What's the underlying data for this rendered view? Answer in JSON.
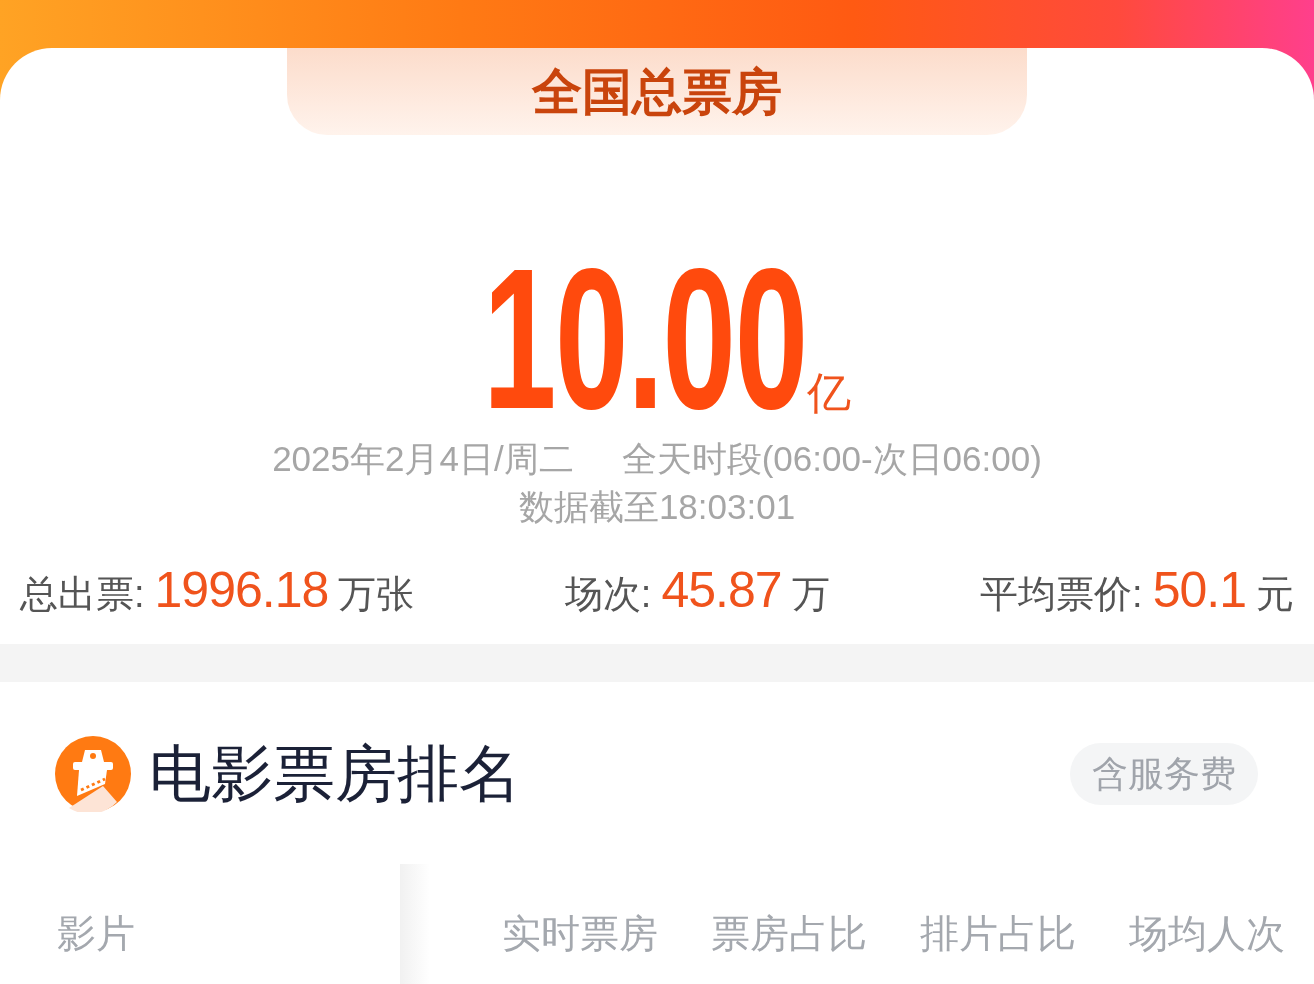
{
  "header": {
    "title": "全国总票房"
  },
  "summary": {
    "total": "10.00",
    "unit": "亿",
    "date": "2025年2月4日/周二",
    "period": "全天时段(06:00-次日06:00)",
    "updated": "数据截至18:03:01",
    "stats": [
      {
        "label": "总出票:",
        "value": "1996.18",
        "unit": "万张"
      },
      {
        "label": "场次:",
        "value": "45.87",
        "unit": "万"
      },
      {
        "label": "平均票价:",
        "value": "50.1",
        "unit": "元"
      }
    ]
  },
  "ranking": {
    "title": "电影票房排名",
    "badge": "含服务费",
    "columns": [
      "影片",
      "实时票房",
      "票房占比",
      "排片占比",
      "场均人次"
    ]
  }
}
